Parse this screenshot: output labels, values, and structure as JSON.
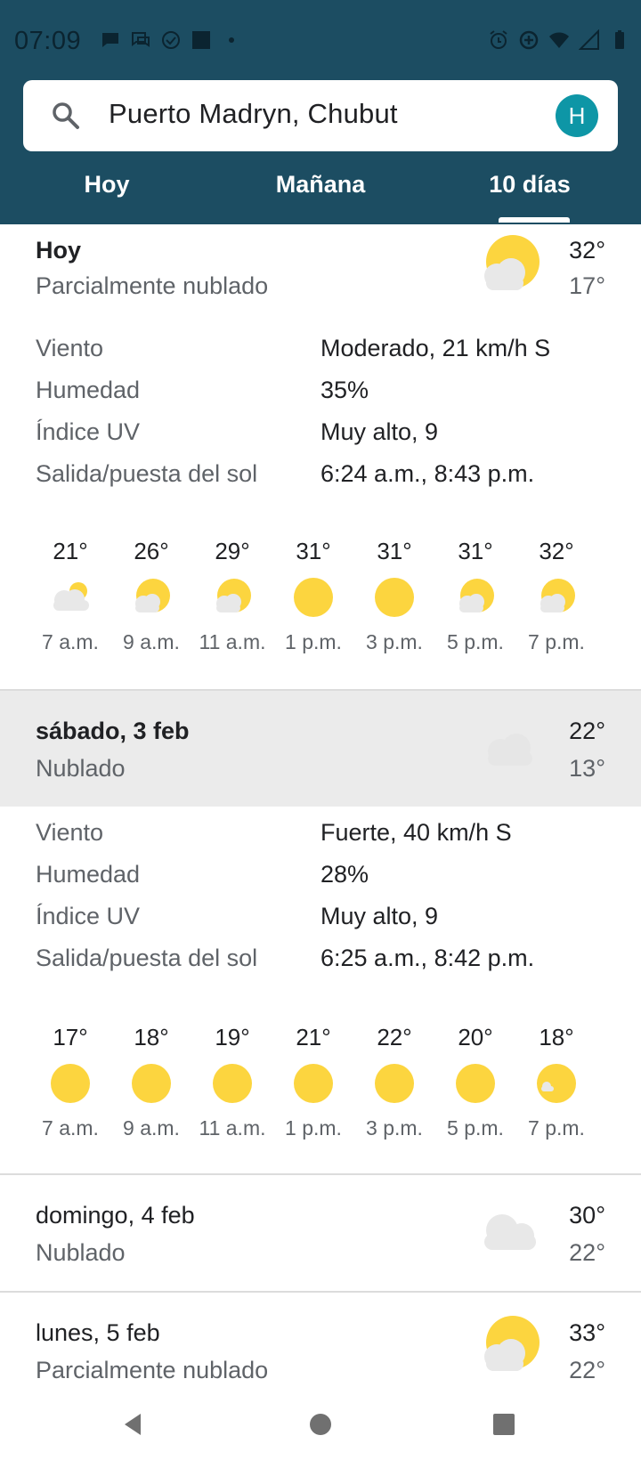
{
  "status": {
    "time": "07:09"
  },
  "search": {
    "location": "Puerto Madryn, Chubut",
    "avatar_letter": "H"
  },
  "tabs": [
    {
      "label": "Hoy"
    },
    {
      "label": "Mañana"
    },
    {
      "label": "10 días"
    }
  ],
  "days": [
    {
      "name": "Hoy",
      "condition": "Parcialmente nublado",
      "high": "32°",
      "low": "17°",
      "icon": "partly-cloudy-icon",
      "details": [
        {
          "label": "Viento",
          "value": "Moderado, 21 km/h S"
        },
        {
          "label": "Humedad",
          "value": "35%"
        },
        {
          "label": "Índice UV",
          "value": "Muy alto, 9"
        },
        {
          "label": "Salida/puesta del sol",
          "value": "6:24 a.m., 8:43 p.m."
        }
      ],
      "hourly": [
        {
          "temp": "21°",
          "time": "7 a.m.",
          "icon": "cloudy-sun-icon"
        },
        {
          "temp": "26°",
          "time": "9 a.m.",
          "icon": "partly-cloudy-icon"
        },
        {
          "temp": "29°",
          "time": "11 a.m.",
          "icon": "partly-cloudy-icon"
        },
        {
          "temp": "31°",
          "time": "1 p.m.",
          "icon": "sun-icon"
        },
        {
          "temp": "31°",
          "time": "3 p.m.",
          "icon": "sun-icon"
        },
        {
          "temp": "31°",
          "time": "5 p.m.",
          "icon": "partly-cloudy-icon"
        },
        {
          "temp": "32°",
          "time": "7 p.m.",
          "icon": "partly-cloudy-icon"
        }
      ]
    },
    {
      "name": "sábado, 3 feb",
      "condition": "Nublado",
      "high": "22°",
      "low": "13°",
      "icon": "cloud-icon",
      "details": [
        {
          "label": "Viento",
          "value": "Fuerte, 40 km/h S"
        },
        {
          "label": "Humedad",
          "value": "28%"
        },
        {
          "label": "Índice UV",
          "value": "Muy alto, 9"
        },
        {
          "label": "Salida/puesta del sol",
          "value": "6:25 a.m., 8:42 p.m."
        }
      ],
      "hourly": [
        {
          "temp": "17°",
          "time": "7 a.m.",
          "icon": "sun-icon"
        },
        {
          "temp": "18°",
          "time": "9 a.m.",
          "icon": "sun-icon"
        },
        {
          "temp": "19°",
          "time": "11 a.m.",
          "icon": "sun-icon"
        },
        {
          "temp": "21°",
          "time": "1 p.m.",
          "icon": "sun-icon"
        },
        {
          "temp": "22°",
          "time": "3 p.m.",
          "icon": "sun-icon"
        },
        {
          "temp": "20°",
          "time": "5 p.m.",
          "icon": "sun-icon"
        },
        {
          "temp": "18°",
          "time": "7 p.m.",
          "icon": "sun-small-cloud-icon"
        }
      ]
    },
    {
      "name": "domingo, 4 feb",
      "condition": "Nublado",
      "high": "30°",
      "low": "22°",
      "icon": "cloud-icon"
    },
    {
      "name": "lunes, 5 feb",
      "condition": "Parcialmente nublado",
      "high": "33°",
      "low": "22°",
      "icon": "partly-cloudy-icon"
    }
  ],
  "colors": {
    "header": "#1c4d62",
    "sun": "#fcd53f",
    "cloud": "#e8e8e8",
    "avatar": "#0e96a6",
    "band": "#ebebeb"
  }
}
